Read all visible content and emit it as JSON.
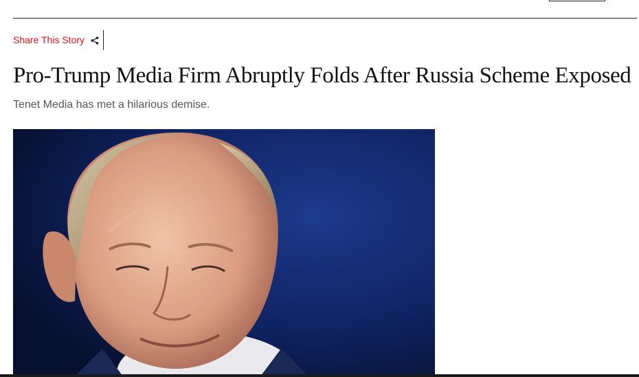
{
  "share": {
    "label": "Share This Story",
    "icon": "share-icon",
    "color": "#e3131b"
  },
  "article": {
    "headline": "Pro-Trump Media Firm Abruptly Folds After Russia Scheme Exposed",
    "dek": "Tenet Media has met a hilarious demise."
  },
  "hero_image": {
    "background": "#0d1d4a"
  }
}
